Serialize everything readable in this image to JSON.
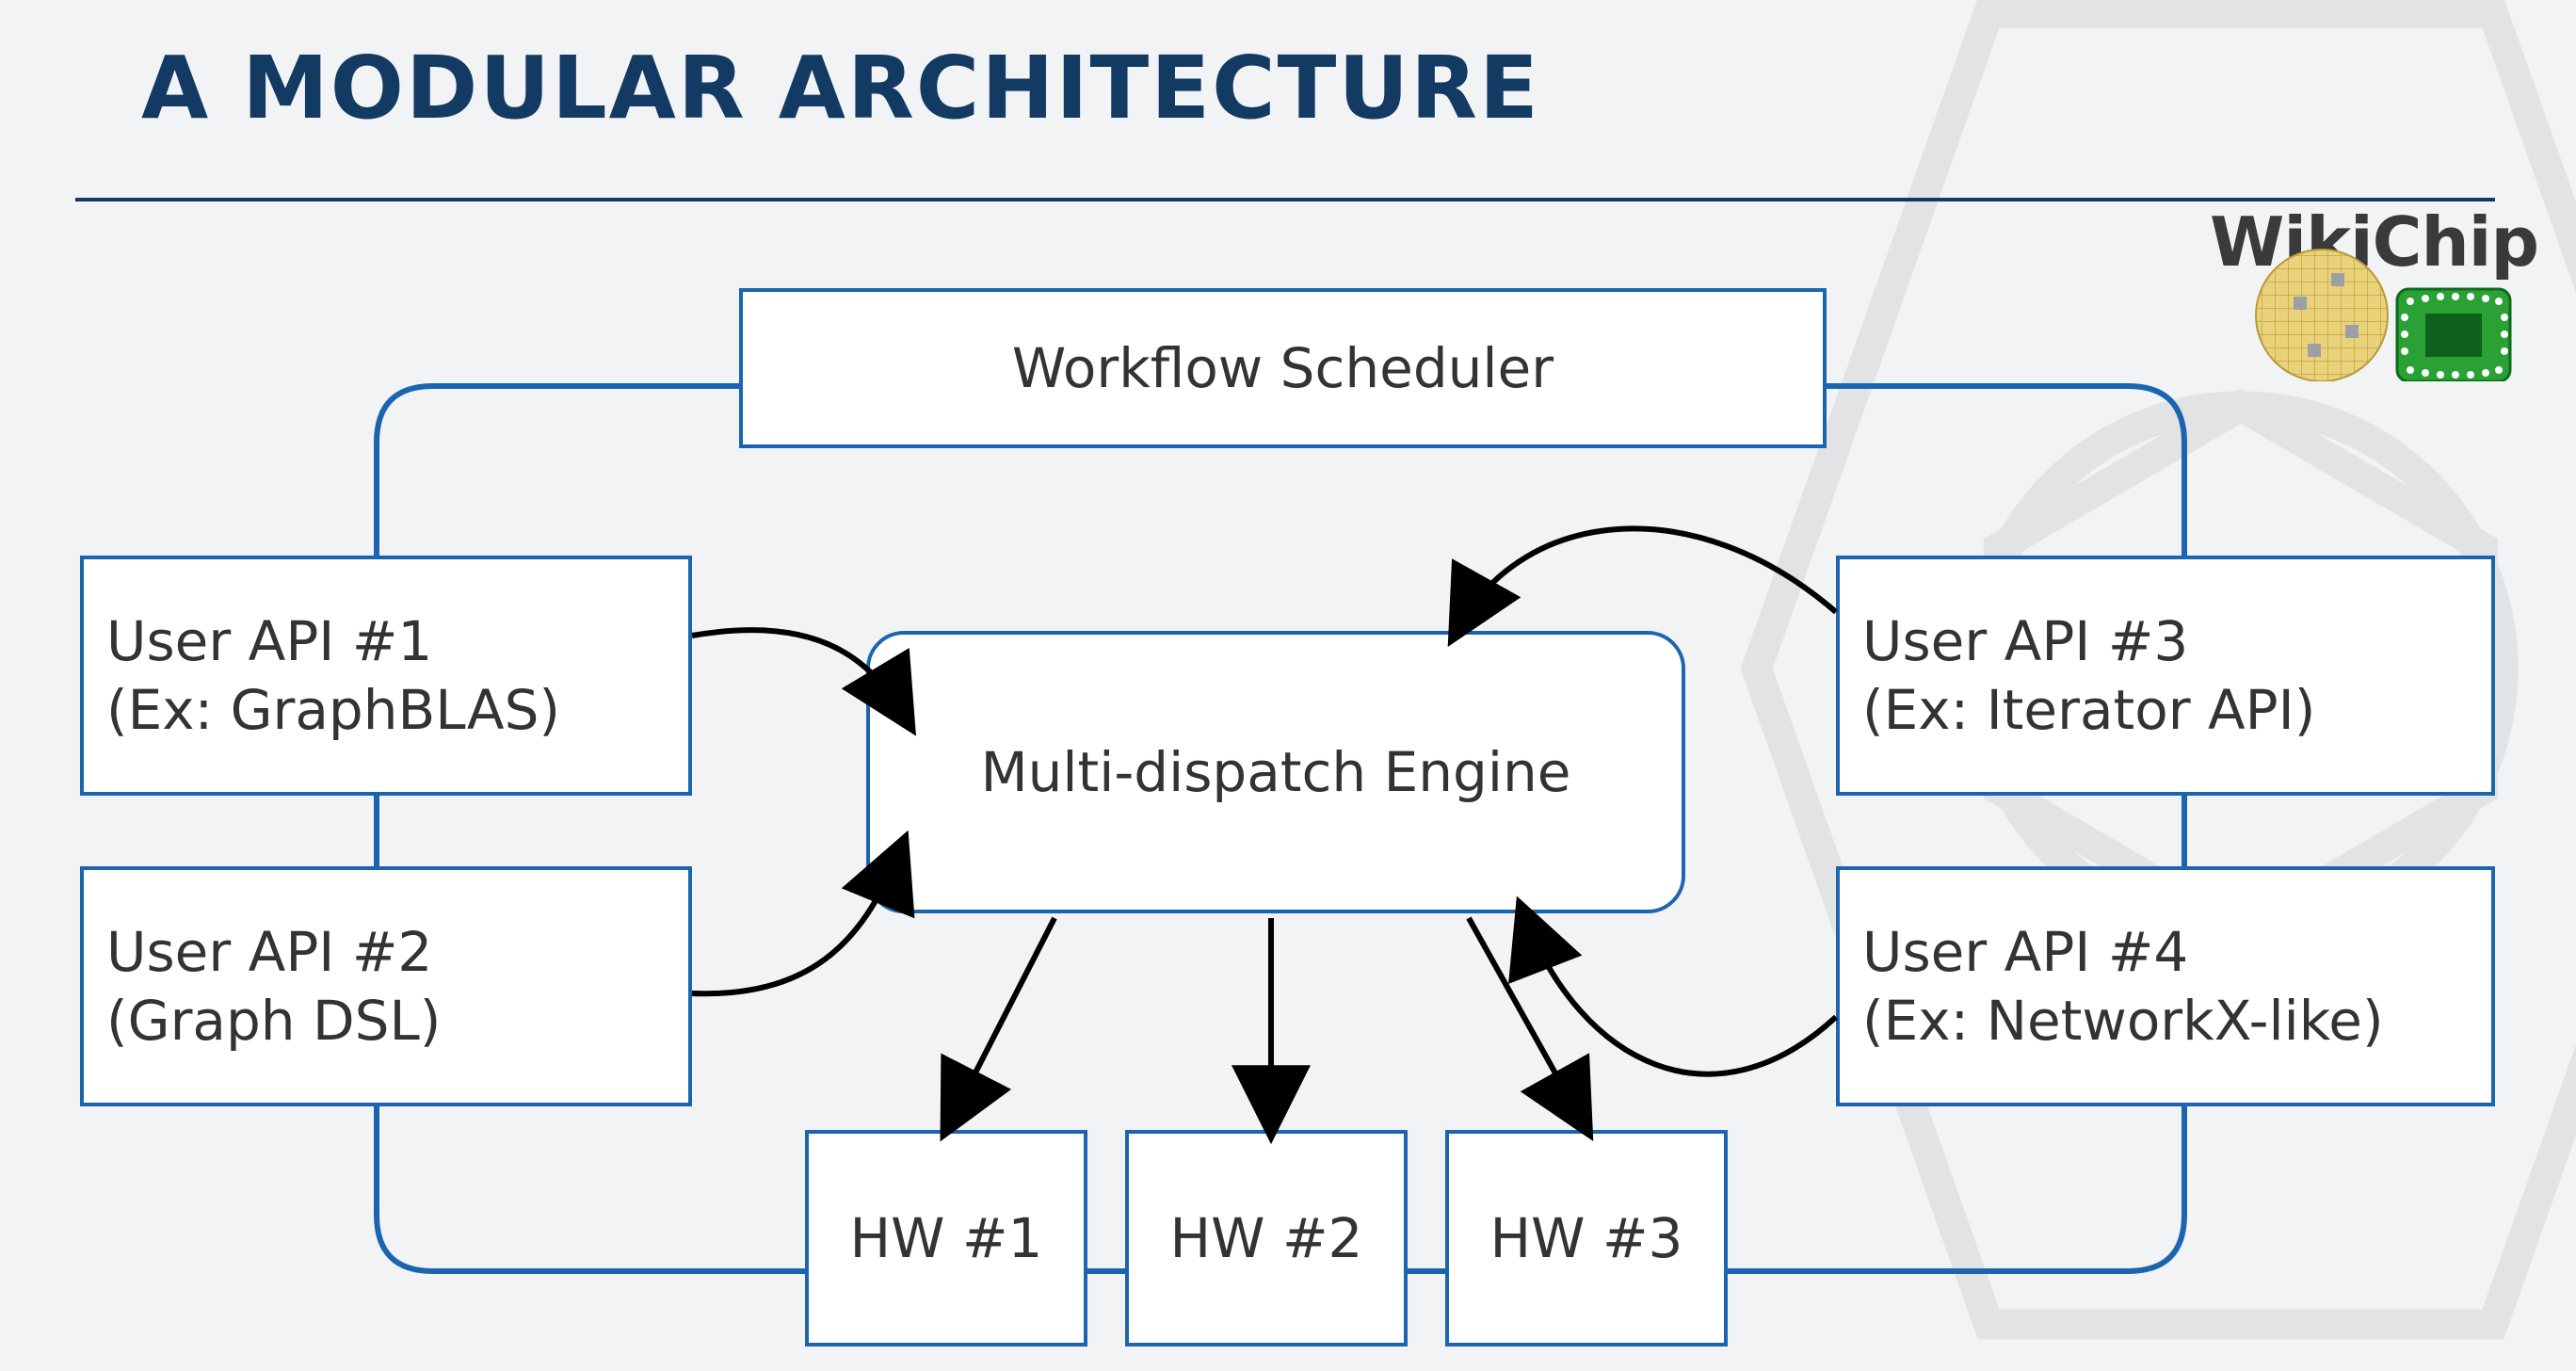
{
  "title": "A MODULAR ARCHITECTURE",
  "logo_text": "WikiChip",
  "diagram": {
    "workflow_scheduler": "Workflow Scheduler",
    "multi_dispatch_engine": "Multi-dispatch Engine",
    "user_api_1_line1": "User API #1",
    "user_api_1_line2": "(Ex: GraphBLAS)",
    "user_api_2_line1": "User API #2",
    "user_api_2_line2": "(Graph DSL)",
    "user_api_3_line1": "User API #3",
    "user_api_3_line2": "(Ex: Iterator API)",
    "user_api_4_line1": "User API #4",
    "user_api_4_line2": "(Ex: NetworkX-like)",
    "hw_1": "HW #1",
    "hw_2": "HW #2",
    "hw_3": "HW #3"
  },
  "chart_data": {
    "type": "diagram",
    "title": "A Modular Architecture",
    "nodes": [
      {
        "id": "workflow_scheduler",
        "label": "Workflow Scheduler"
      },
      {
        "id": "multi_dispatch_engine",
        "label": "Multi-dispatch Engine"
      },
      {
        "id": "user_api_1",
        "label": "User API #1 (Ex: GraphBLAS)"
      },
      {
        "id": "user_api_2",
        "label": "User API #2 (Graph DSL)"
      },
      {
        "id": "user_api_3",
        "label": "User API #3 (Ex: Iterator API)"
      },
      {
        "id": "user_api_4",
        "label": "User API #4 (Ex: NetworkX-like)"
      },
      {
        "id": "hw_1",
        "label": "HW #1"
      },
      {
        "id": "hw_2",
        "label": "HW #2"
      },
      {
        "id": "hw_3",
        "label": "HW #3"
      }
    ],
    "edges": [
      {
        "from": "workflow_scheduler",
        "to": "user_api_1",
        "kind": "bus"
      },
      {
        "from": "workflow_scheduler",
        "to": "user_api_2",
        "kind": "bus"
      },
      {
        "from": "workflow_scheduler",
        "to": "user_api_3",
        "kind": "bus"
      },
      {
        "from": "workflow_scheduler",
        "to": "user_api_4",
        "kind": "bus"
      },
      {
        "from": "workflow_scheduler",
        "to": "hw_1",
        "kind": "bus"
      },
      {
        "from": "workflow_scheduler",
        "to": "hw_2",
        "kind": "bus"
      },
      {
        "from": "workflow_scheduler",
        "to": "hw_3",
        "kind": "bus"
      },
      {
        "from": "user_api_1",
        "to": "multi_dispatch_engine",
        "kind": "arrow"
      },
      {
        "from": "user_api_2",
        "to": "multi_dispatch_engine",
        "kind": "arrow"
      },
      {
        "from": "user_api_3",
        "to": "multi_dispatch_engine",
        "kind": "arrow"
      },
      {
        "from": "user_api_4",
        "to": "multi_dispatch_engine",
        "kind": "arrow"
      },
      {
        "from": "multi_dispatch_engine",
        "to": "hw_1",
        "kind": "arrow"
      },
      {
        "from": "multi_dispatch_engine",
        "to": "hw_2",
        "kind": "arrow"
      },
      {
        "from": "multi_dispatch_engine",
        "to": "hw_3",
        "kind": "arrow"
      }
    ]
  }
}
